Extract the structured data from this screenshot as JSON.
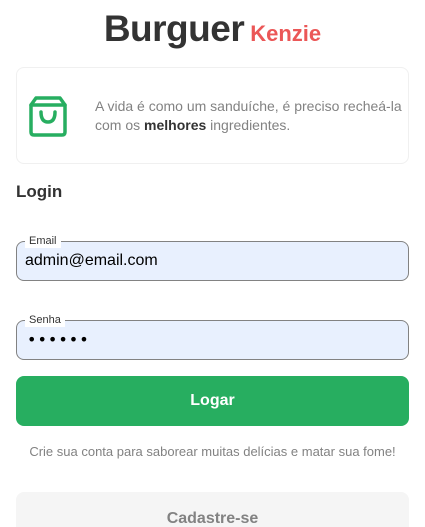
{
  "brand": {
    "main": "Burguer",
    "sub": "Kenzie",
    "colors": {
      "main": "#333333",
      "sub": "#eb5757"
    }
  },
  "info_card": {
    "icon": "shopping-bag-icon",
    "icon_color": "#27ae60",
    "text_before": "A vida é como um sanduíche, é preciso recheá-la com os ",
    "text_bold": "melhores",
    "text_after": " ingredientes."
  },
  "login": {
    "title": "Login",
    "email": {
      "label": "Email",
      "value": "admin@email.com"
    },
    "password": {
      "label": "Senha",
      "masked_value": "••••••"
    },
    "submit_label": "Logar",
    "submit_color": "#27ae60"
  },
  "signup": {
    "prompt": "Crie sua conta para saborear muitas delícias e matar sua fome!",
    "button_label": "Cadastre-se"
  }
}
